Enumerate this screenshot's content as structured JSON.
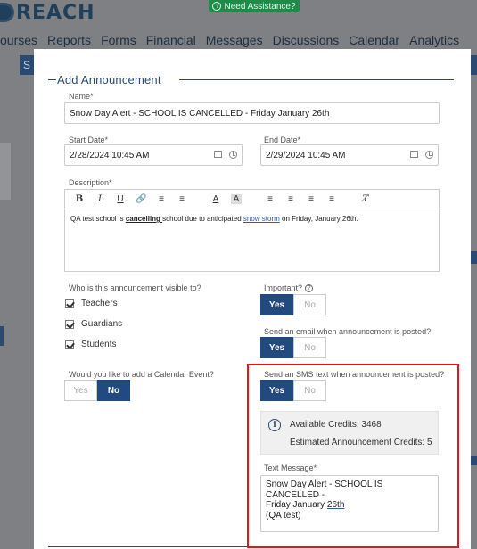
{
  "app": {
    "logo_text": "REACH",
    "assist_label": "Need Assistance?",
    "nav": [
      "ourses",
      "Reports",
      "Forms",
      "Financial",
      "Messages",
      "Discussions",
      "Calendar",
      "Analytics"
    ],
    "bg_tab": "S"
  },
  "modal": {
    "title": "Add Announcement",
    "name": {
      "label": "Name*",
      "value": "Snow Day Alert - SCHOOL IS CANCELLED - Friday January 26th"
    },
    "start_date": {
      "label": "Start Date*",
      "value": "2/28/2024 10:45 AM"
    },
    "end_date": {
      "label": "End Date*",
      "value": "2/29/2024 10:45 AM"
    },
    "description": {
      "label": "Description*",
      "toolbar": [
        "B",
        "I",
        "U",
        "link",
        "ordered-list",
        "bullet-list",
        "A",
        "A-bg",
        "align-left",
        "align-center",
        "align-right",
        "justify",
        "clear-format"
      ],
      "text_1": "QA test school is ",
      "text_bold": "cancelling ",
      "text_2": "school due to anticipated ",
      "text_link": "snow storm",
      "text_3": " on Friday, January 26th."
    },
    "visible_to": {
      "label": "Who is this announcement visible to?",
      "options": [
        {
          "label": "Teachers",
          "checked": true
        },
        {
          "label": "Guardians",
          "checked": true
        },
        {
          "label": "Students",
          "checked": true
        }
      ]
    },
    "important": {
      "label": "Important?",
      "yes": "Yes",
      "no": "No",
      "selected": "Yes"
    },
    "send_email": {
      "label": "Send an email when announcement is posted?",
      "yes": "Yes",
      "no": "No",
      "selected": "Yes"
    },
    "calendar_event": {
      "label": "Would you like to add a Calendar Event?",
      "yes": "Yes",
      "no": "No",
      "selected": "No"
    },
    "send_sms": {
      "label": "Send an SMS text when announcement is posted?",
      "yes": "Yes",
      "no": "No",
      "selected": "Yes"
    },
    "credits": {
      "available": "Available Credits: 3468",
      "estimated": "Estimated Announcement Credits: 5"
    },
    "text_message": {
      "label": "Text Message*",
      "line_1": "Snow Day Alert - SCHOOL IS CANCELLED -",
      "line_2a": "Friday January ",
      "line_2b": "26th",
      "line_3": "(QA test)"
    }
  },
  "colors": {
    "primary": "#234a80",
    "highlight": "#e01818",
    "assist": "#1f8a4a"
  }
}
